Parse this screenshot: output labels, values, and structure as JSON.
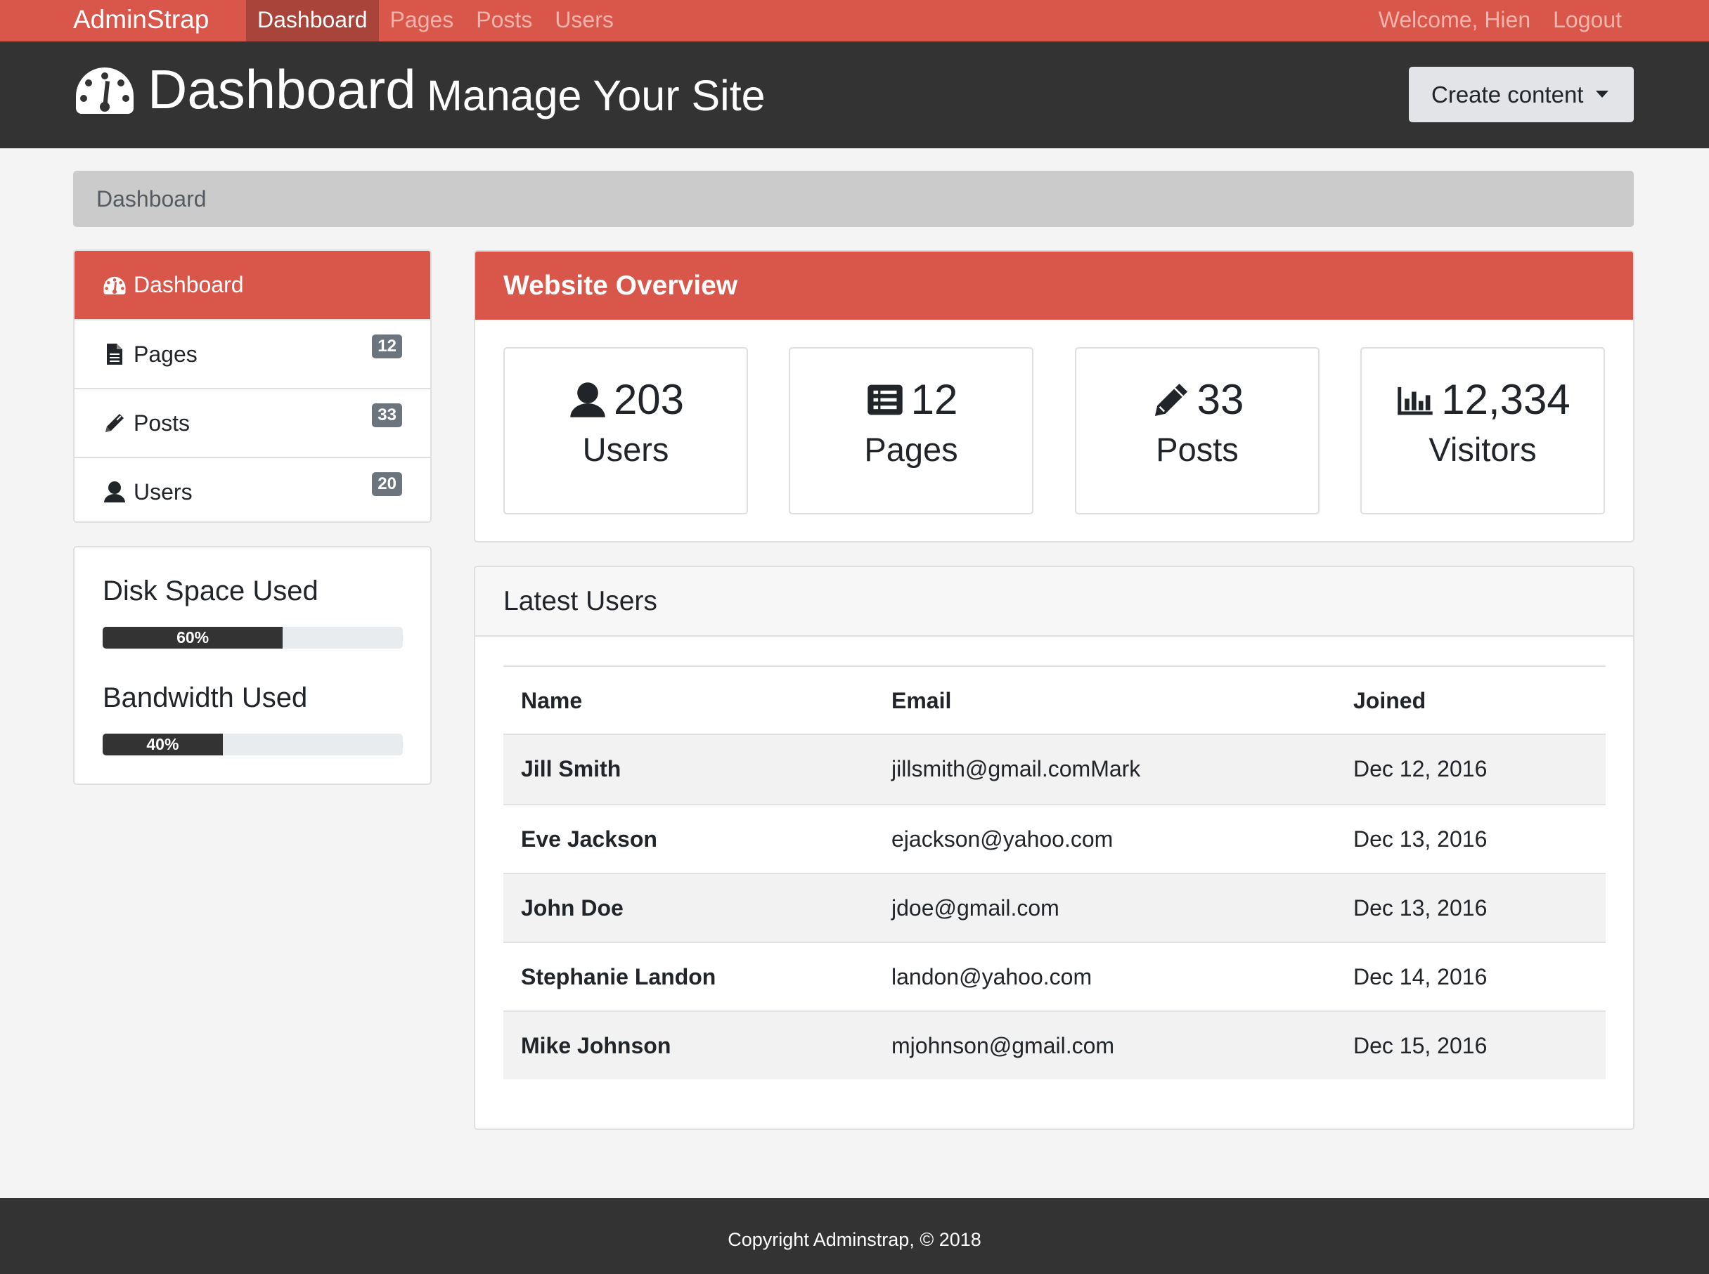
{
  "navbar": {
    "brand": "AdminStrap",
    "links": [
      "Dashboard",
      "Pages",
      "Posts",
      "Users"
    ],
    "welcome": "Welcome, Hien",
    "logout": "Logout"
  },
  "header": {
    "title": "Dashboard",
    "subtitle": "Manage Your Site",
    "create_button": "Create content"
  },
  "breadcrumb": "Dashboard",
  "sidebar": {
    "items": [
      {
        "label": "Dashboard",
        "icon": "dashboard-gauge-icon"
      },
      {
        "label": "Pages",
        "icon": "file-icon",
        "count": "12"
      },
      {
        "label": "Posts",
        "icon": "pencil-icon",
        "count": "33"
      },
      {
        "label": "Users",
        "icon": "user-icon",
        "count": "20"
      }
    ]
  },
  "usage": {
    "disk": {
      "label": "Disk Space Used",
      "percent_text": "60%",
      "value": 0.6
    },
    "bandwidth": {
      "label": "Bandwidth Used",
      "percent_text": "40%",
      "value": 0.4
    }
  },
  "overview": {
    "title": "Website Overview",
    "stats": [
      {
        "value": "203",
        "label": "Users",
        "icon": "user-icon"
      },
      {
        "value": "12",
        "label": "Pages",
        "icon": "list-icon"
      },
      {
        "value": "33",
        "label": "Posts",
        "icon": "pencil-icon"
      },
      {
        "value": "12,334",
        "label": "Visitors",
        "icon": "bar-chart-icon"
      }
    ]
  },
  "latest_users": {
    "title": "Latest Users",
    "columns": [
      "Name",
      "Email",
      "Joined"
    ],
    "rows": [
      {
        "name": "Jill Smith",
        "email": "jillsmith@gmail.comMark",
        "joined": "Dec 12, 2016"
      },
      {
        "name": "Eve Jackson",
        "email": "ejackson@yahoo.com",
        "joined": "Dec 13, 2016"
      },
      {
        "name": "John Doe",
        "email": "jdoe@gmail.com",
        "joined": "Dec 13, 2016"
      },
      {
        "name": "Stephanie Landon",
        "email": "landon@yahoo.com",
        "joined": "Dec 14, 2016"
      },
      {
        "name": "Mike Johnson",
        "email": "mjohnson@gmail.com",
        "joined": "Dec 15, 2016"
      }
    ]
  },
  "footer": "Copyright Adminstrap, © 2018",
  "colors": {
    "primary": "#d9574a",
    "dark": "#333333",
    "muted_link": "#f5b3ab",
    "background": "#f4f4f4"
  }
}
